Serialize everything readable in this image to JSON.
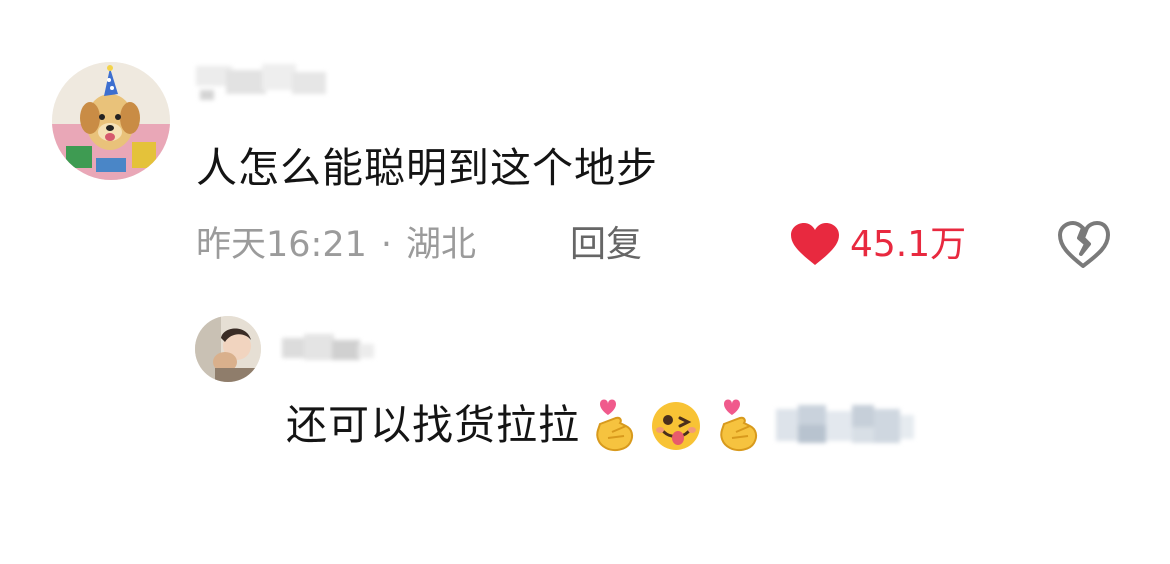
{
  "comment": {
    "text": "人怎么能聪明到这个地步",
    "time": "昨天16:21",
    "separator": "·",
    "location": "湖北",
    "reply_label": "回复",
    "like_count": "45.1万"
  },
  "reply": {
    "text": "还可以找货拉拉"
  },
  "colors": {
    "like": "#e8293f",
    "meta": "#9b9b9b",
    "text": "#141414"
  },
  "icons": {
    "like": "heart-icon",
    "dislike": "broken-heart-icon",
    "emoji_1": "finger-heart-emoji",
    "emoji_2": "winking-tongue-emoji",
    "emoji_3": "finger-heart-emoji"
  }
}
